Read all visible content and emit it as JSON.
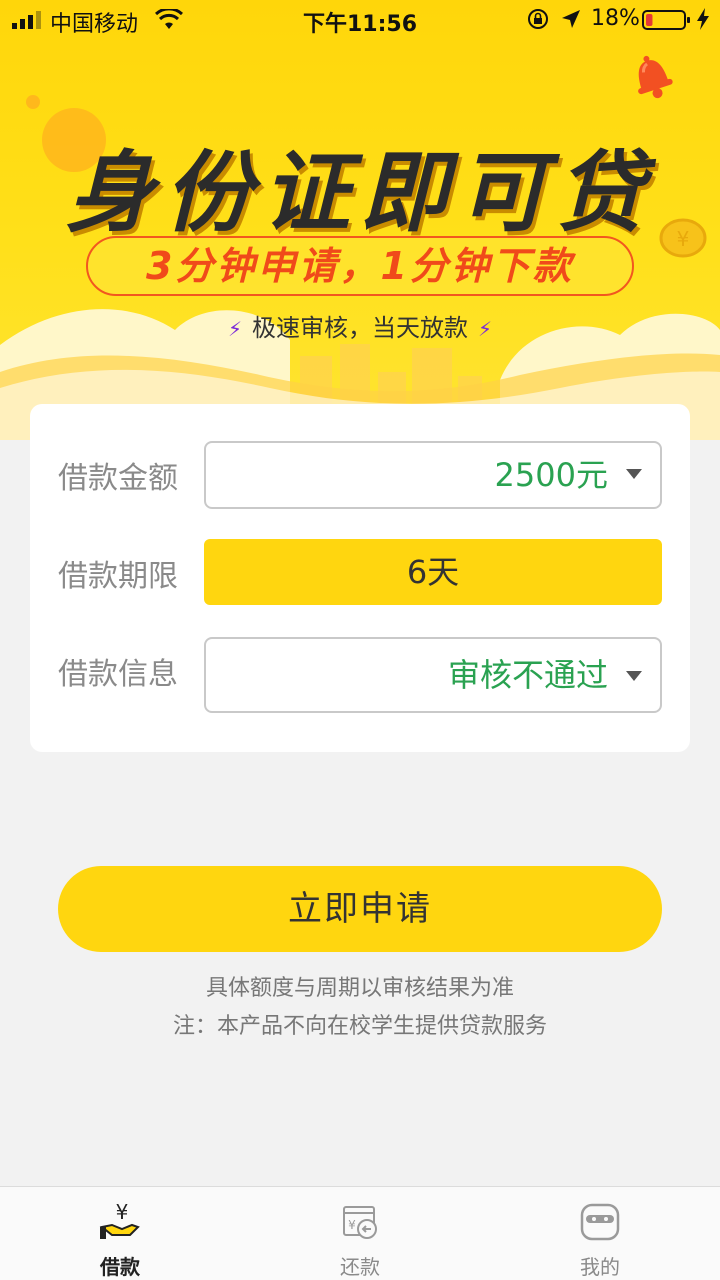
{
  "status_bar": {
    "carrier": "中国移动",
    "time": "下午11:56",
    "battery": "18%",
    "battery_level": 0.18
  },
  "hero": {
    "title": "身份证即可贷",
    "subtitle": "3分钟申请，1分钟下款",
    "note": "极速审核，当天放款"
  },
  "form": {
    "amount_label": "借款金额",
    "amount_value": "2500元",
    "term_label": "借款期限",
    "term_value": "6天",
    "info_label": "借款信息",
    "info_value": "审核不通过"
  },
  "apply": {
    "button_label": "立即申请",
    "note1": "具体额度与周期以审核结果为准",
    "note2": "注：本产品不向在校学生提供贷款服务"
  },
  "tabs": [
    {
      "label": "借款",
      "icon": "loan-icon",
      "active": true
    },
    {
      "label": "还款",
      "icon": "repay-icon",
      "active": false
    },
    {
      "label": "我的",
      "icon": "profile-icon",
      "active": false
    }
  ],
  "colors": {
    "brand_yellow": "#ffd60f",
    "value_green": "#2aa251",
    "accent_red": "#f04a1a"
  }
}
